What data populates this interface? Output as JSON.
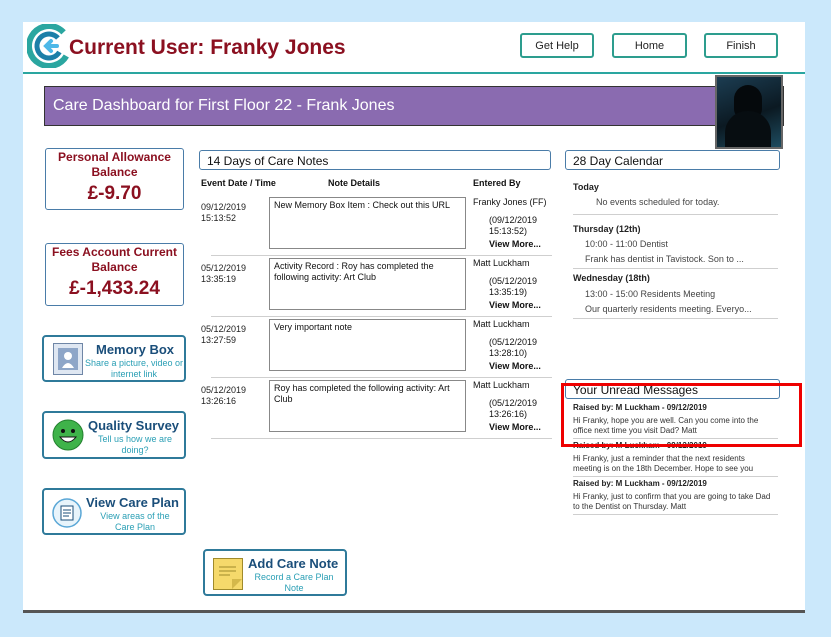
{
  "header": {
    "title": "Current User: Franky Jones",
    "buttons": {
      "help": "Get Help",
      "home": "Home",
      "finish": "Finish"
    }
  },
  "banner": {
    "title": "Care Dashboard for First Floor 22 - Frank Jones"
  },
  "balances": {
    "allowance": {
      "label": "Personal Allowance Balance",
      "value": "£-9.70"
    },
    "fees": {
      "label": "Fees Account Current Balance",
      "value": "£-1,433.24"
    }
  },
  "tiles": {
    "memory": {
      "title": "Memory Box",
      "subtitle": "Share a picture, video or internet link"
    },
    "survey": {
      "title": "Quality Survey",
      "subtitle": "Tell us how we are doing?"
    },
    "careplan": {
      "title": "View Care Plan",
      "subtitle": "View areas of the Care Plan"
    },
    "addnote": {
      "title": "Add Care Note",
      "subtitle": "Record a Care Plan Note"
    }
  },
  "care_notes": {
    "title": "14 Days of Care Notes",
    "columns": {
      "date": "Event Date / Time",
      "details": "Note Details",
      "entered": "Entered By"
    },
    "view_more": "View More...",
    "rows": [
      {
        "date": "09/12/2019",
        "time": "15:13:52",
        "note": "New Memory Box Item : Check out this URL",
        "author": "Franky Jones (FF)",
        "entered_date": "(09/12/2019",
        "entered_time": "15:13:52)"
      },
      {
        "date": "05/12/2019",
        "time": "13:35:19",
        "note": "Activity Record : Roy has completed the following activity: Art Club",
        "author": "Matt Luckham",
        "entered_date": "(05/12/2019",
        "entered_time": "13:35:19)"
      },
      {
        "date": "05/12/2019",
        "time": "13:27:59",
        "note": "Very important note",
        "author": "Matt Luckham",
        "entered_date": "(05/12/2019",
        "entered_time": "13:28:10)"
      },
      {
        "date": "05/12/2019",
        "time": "13:26:16",
        "note": "Roy has completed the following activity: Art Club",
        "author": "Matt Luckham",
        "entered_date": "(05/12/2019",
        "entered_time": "13:26:16)"
      }
    ]
  },
  "calendar": {
    "title": "28 Day Calendar",
    "today": {
      "label": "Today",
      "text": "No events scheduled for today."
    },
    "days": [
      {
        "label": "Thursday (12th)",
        "time": "10:00 - 11:00 Dentist",
        "text": "Frank has dentist in Tavistock.  Son to ..."
      },
      {
        "label": "Wednesday (18th)",
        "time": "13:00 - 15:00 Residents Meeting",
        "text": "Our quarterly residents meeting.  Everyo..."
      }
    ]
  },
  "messages": {
    "title": "Your Unread Messages",
    "items": [
      {
        "raised": "Raised by: M Luckham - 09/12/2019",
        "body": "Hi Franky, hope you are well.  Can you come into the office next time you visit Dad?  Matt"
      },
      {
        "raised": "Raised by: M Luckham - 09/12/2019",
        "body": "Hi Franky, just a reminder that the next residents meeting is on the 18th December.  Hope to see you"
      },
      {
        "raised": "Raised by: M Luckham - 09/12/2019",
        "body": "Hi Franky, just to confirm that you are going to take Dad to the Dentist on Thursday.  Matt"
      }
    ]
  },
  "colors": {
    "title_red": "#8b1020",
    "banner_purple": "#8a6bb0",
    "teal": "#2aa6a0",
    "highlight_red": "#e00000"
  }
}
